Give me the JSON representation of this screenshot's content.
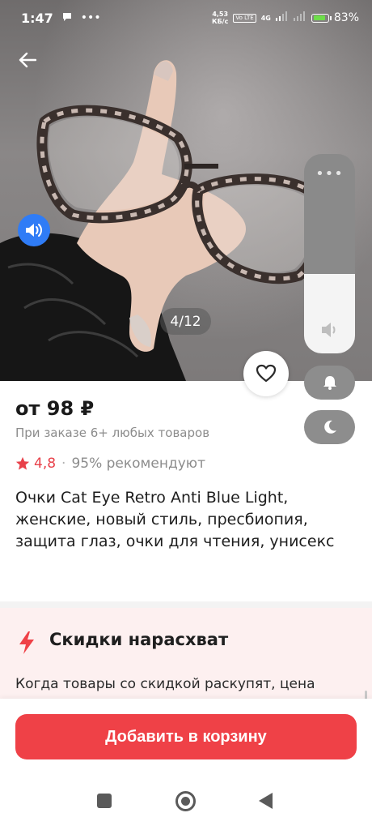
{
  "status_bar": {
    "time": "1:47",
    "net_speed_top": "4,53",
    "net_speed_bottom": "КБ/с",
    "volte_label": "Vo LTE",
    "net_type": "4G",
    "battery": "83%"
  },
  "gallery": {
    "counter": "4/12"
  },
  "product": {
    "price": "от 98 ₽",
    "price_note": "При заказе 6+ любых товаров",
    "rating": "4,8",
    "separator": "·",
    "recommend": "95% рекомендуют",
    "title": "Очки Cat Eye Retro Anti Blue Light, женские, новый стиль, пресбиопия, защита глаз, очки для чтения, унисекс"
  },
  "promo": {
    "title": "Скидки нарасхват",
    "text": "Когда товары со скидкой раскупят, цена"
  },
  "actions": {
    "add_to_cart": "Добавить в корзину"
  },
  "volume_overlay": {
    "menu_glyph": "•••",
    "level": 0.4
  },
  "colors": {
    "accent": "#ef4147",
    "rating": "#e8414a",
    "sound_button": "#2f7cf6",
    "promo_bg": "#fdf0f0"
  },
  "icons": [
    "back-arrow-icon",
    "speaker-icon",
    "heart-icon",
    "star-icon",
    "lightning-icon",
    "bell-icon",
    "moon-icon",
    "volume-icon"
  ]
}
